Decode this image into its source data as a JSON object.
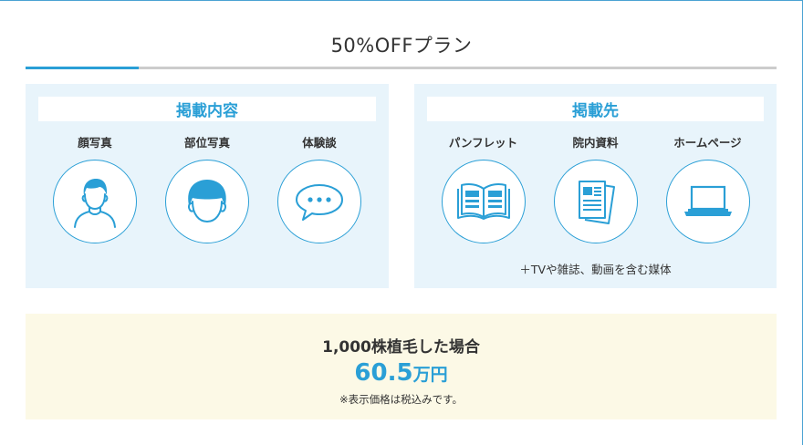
{
  "plan": {
    "title": "50%OFFプラン"
  },
  "content_panel": {
    "header": "掲載内容",
    "items": [
      {
        "label": "顔写真",
        "icon": "face-photo-icon"
      },
      {
        "label": "部位写真",
        "icon": "head-photo-icon"
      },
      {
        "label": "体験談",
        "icon": "speech-bubble-icon"
      }
    ]
  },
  "media_panel": {
    "header": "掲載先",
    "items": [
      {
        "label": "パンフレット",
        "icon": "pamphlet-icon"
      },
      {
        "label": "院内資料",
        "icon": "documents-icon"
      },
      {
        "label": "ホームページ",
        "icon": "laptop-icon"
      }
    ],
    "note": "＋TVや雑誌、動画を含む媒体"
  },
  "price": {
    "case_label": "1,000株植毛した場合",
    "amount": "60.5",
    "unit": "万円",
    "tax_note": "※表示価格は税込みです。"
  },
  "colors": {
    "accent": "#2a9fd6",
    "panel_bg": "#e8f4fb",
    "price_bg": "#fcf9e6"
  }
}
